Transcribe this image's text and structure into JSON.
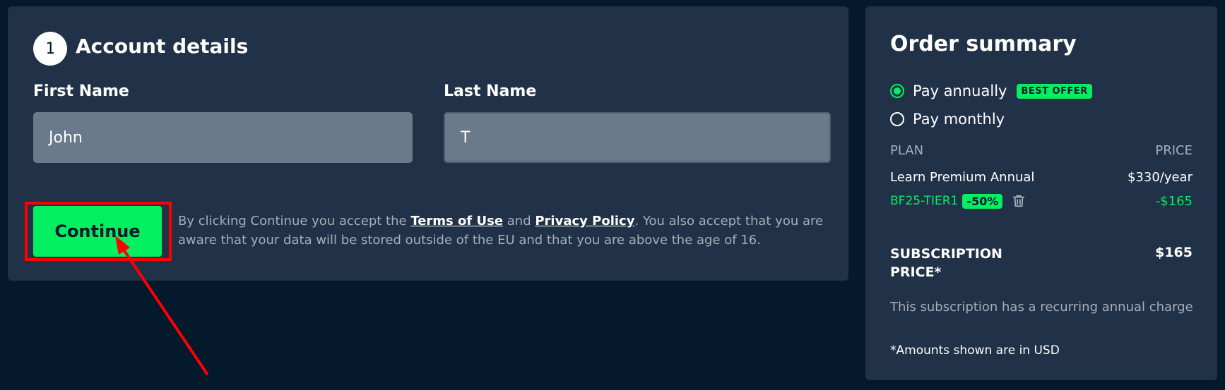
{
  "account": {
    "step_number": "1",
    "title": "Account details",
    "first_name_label": "First Name",
    "first_name_value": "John",
    "last_name_label": "Last Name",
    "last_name_value": "T",
    "continue_label": "Continue",
    "legal": {
      "part1": "By clicking Continue you accept the ",
      "terms_link": "Terms of Use",
      "part2": " and ",
      "privacy_link": "Privacy Policy",
      "part3": ". You also accept that you are aware that your data will be stored outside of the EU and that you are above the age of 16."
    }
  },
  "summary": {
    "title": "Order summary",
    "options": [
      {
        "label": "Pay annually",
        "selected": true,
        "badge": "BEST OFFER"
      },
      {
        "label": "Pay monthly",
        "selected": false
      }
    ],
    "plan_header": "PLAN",
    "price_header": "PRICE",
    "plan_name": "Learn Premium Annual",
    "plan_price": "$330/year",
    "promo_code": "BF25-TIER1",
    "promo_discount": "-50%",
    "promo_amount": "-$165",
    "subscription_label": "SUBSCRIPTION PRICE*",
    "subscription_price": "$165",
    "recurring_note": "This subscription has a recurring annual charge",
    "currency_note": "*Amounts shown are in USD"
  },
  "colors": {
    "background": "#05192d",
    "panel": "#213147",
    "accent_green": "#03ef62",
    "annotation_red": "#ff0000"
  },
  "icons": [
    "radio-selected-icon",
    "radio-unselected-icon",
    "trash-icon",
    "annotation-arrow"
  ]
}
